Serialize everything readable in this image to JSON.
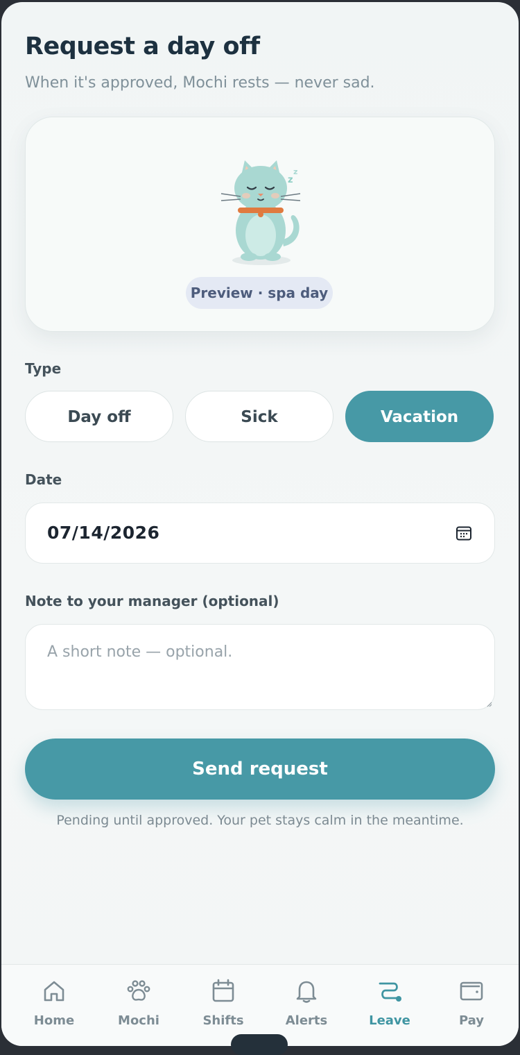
{
  "header": {
    "title": "Request a day off",
    "subtitle": "When it's approved, Mochi rests — never sad."
  },
  "preview": {
    "chip_label": "Preview · spa day"
  },
  "type_section": {
    "label": "Type",
    "options": [
      "Day off",
      "Sick",
      "Vacation"
    ],
    "selected": "Vacation"
  },
  "date_section": {
    "label": "Date",
    "value": "07/14/2026"
  },
  "note_section": {
    "label": "Note to your manager (optional)",
    "placeholder": "A short note — optional."
  },
  "submit": {
    "label": "Send request",
    "helper": "Pending until approved. Your pet stays calm in the meantime."
  },
  "nav": {
    "items": [
      {
        "label": "Home",
        "icon": "home-icon"
      },
      {
        "label": "Mochi",
        "icon": "paw-icon"
      },
      {
        "label": "Shifts",
        "icon": "calendar-icon"
      },
      {
        "label": "Alerts",
        "icon": "bell-icon"
      },
      {
        "label": "Leave",
        "icon": "path-icon"
      },
      {
        "label": "Pay",
        "icon": "wallet-icon"
      }
    ],
    "active": "Leave"
  },
  "colors": {
    "accent": "#4799a6",
    "title": "#1d3140",
    "chip_bg": "#e4e9f4",
    "collar": "#e07a3f",
    "cat_body": "#a9d8d2"
  }
}
